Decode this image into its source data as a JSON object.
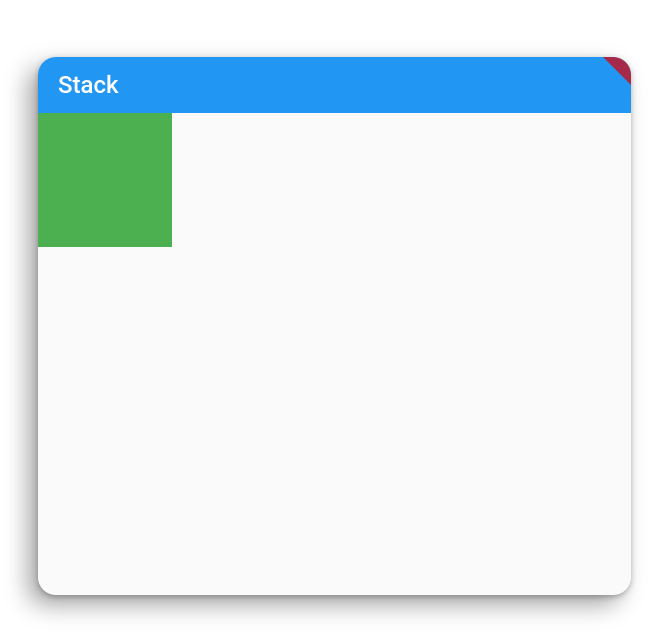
{
  "appBar": {
    "title": "Stack"
  },
  "colors": {
    "appBar": "#2196f3",
    "square": "#4caf50",
    "background": "#fafafa",
    "debugBanner": "#a52a4a"
  }
}
